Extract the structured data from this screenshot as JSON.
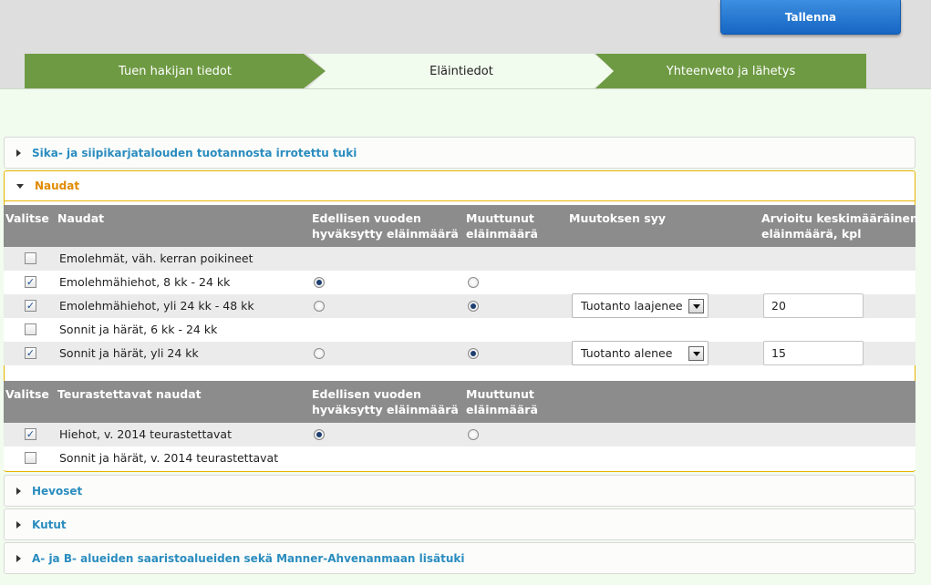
{
  "toolbar": {
    "save_label": "Tallenna"
  },
  "steps": [
    {
      "label": "Tuen hakijan tiedot",
      "state": "done"
    },
    {
      "label": "Eläintiedot",
      "state": "current"
    },
    {
      "label": "Yhteenveto ja lähetys",
      "state": "todo"
    }
  ],
  "sections": {
    "sika": "Sika- ja siipikarjatalouden tuotannosta irrotettu tuki",
    "naudat": "Naudat",
    "hevoset": "Hevoset",
    "kutut": "Kutut",
    "saaristo": "A- ja B- alueiden saaristoalueiden sekä Manner-Ahvenanmaan lisätuki"
  },
  "naudat_table": {
    "headers": {
      "valitse": "Valitse",
      "naudat": "Naudat",
      "edellinen_1": "Edellisen vuoden",
      "edellinen_2": "hyväksytty eläinmäärä",
      "muuttunut_1": "Muuttunut",
      "muuttunut_2": "eläinmäärä",
      "syy": "Muutoksen syy",
      "arvioitu_1": "Arvioitu keskimääräinen",
      "arvioitu_2": "eläinmäärä, kpl"
    },
    "rows": [
      {
        "label": "Emolehmät, väh. kerran poikineet",
        "checked": false
      },
      {
        "label": "Emolehmähiehot, 8 kk - 24 kk",
        "checked": true,
        "choice": "edellinen"
      },
      {
        "label": "Emolehmähiehot, yli 24 kk - 48 kk",
        "checked": true,
        "choice": "muuttunut",
        "reason": "Tuotanto laajenee",
        "amount": "20"
      },
      {
        "label": "Sonnit ja härät, 6 kk - 24 kk",
        "checked": false
      },
      {
        "label": "Sonnit ja härät, yli 24 kk",
        "checked": true,
        "choice": "muuttunut",
        "reason": "Tuotanto alenee",
        "amount": "15"
      }
    ]
  },
  "teuras_table": {
    "headers": {
      "valitse": "Valitse",
      "naudat": "Teurastettavat naudat",
      "edellinen_1": "Edellisen vuoden",
      "edellinen_2": "hyväksytty eläinmäärä",
      "muuttunut_1": "Muuttunut",
      "muuttunut_2": "eläinmäärä"
    },
    "rows": [
      {
        "label": "Hiehot, v. 2014 teurastettavat",
        "checked": true,
        "choice": "edellinen"
      },
      {
        "label": "Sonnit ja härät, v. 2014 teurastettavat",
        "checked": false
      }
    ]
  },
  "colors": {
    "step_green": "#6e9a43",
    "page_bg": "#f1fbee",
    "header_gray": "#8c8c8c",
    "link_blue": "#2a8cbf",
    "open_orange": "#e08a00",
    "button_blue": "#1f74d0"
  },
  "icons": {
    "checkmark": "✓",
    "collapsed": "arrow-right",
    "expanded": "arrow-down"
  }
}
